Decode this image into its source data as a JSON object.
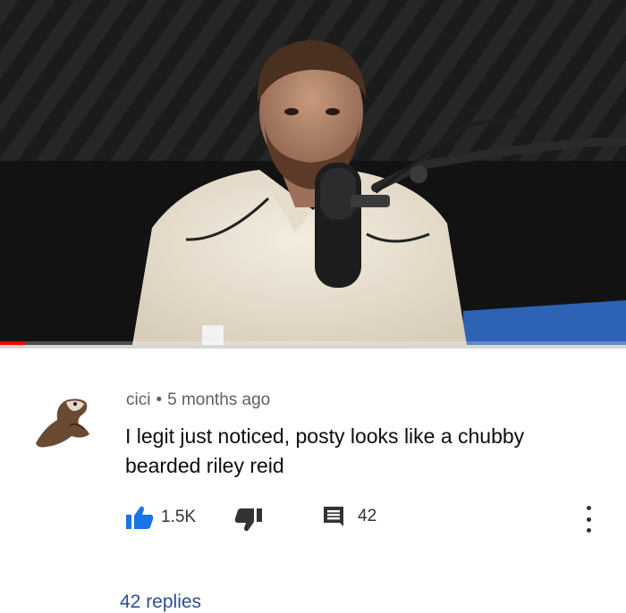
{
  "video": {
    "thumbnail_icon": "video-frame-image",
    "progress_fraction": 0.04,
    "progress_color": "#ff0000"
  },
  "comment": {
    "avatar_icon": "otter-avatar",
    "author": "cici",
    "separator": "•",
    "time": "5 months ago",
    "text": "I legit just noticed, posty looks like a chubby bearded riley reid",
    "likes": "1.5K",
    "reply_count": "42",
    "more_icon": "more-vert-icon",
    "view_replies": "42 replies",
    "colors": {
      "like_blue": "#1a73e8",
      "link_blue": "#2a4f93",
      "meta_gray": "#606060"
    }
  }
}
